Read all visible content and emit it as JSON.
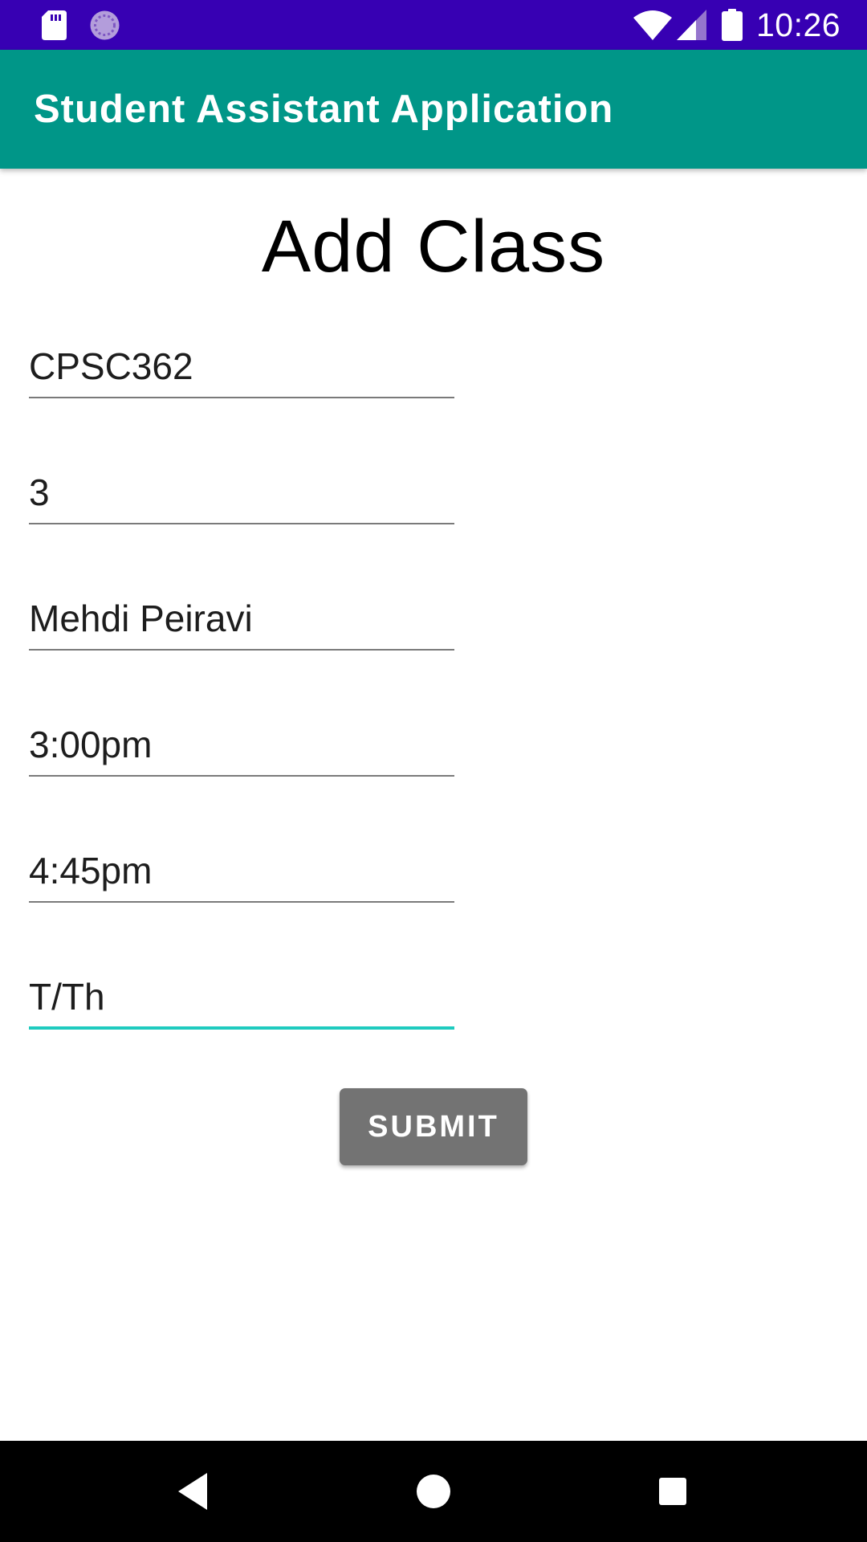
{
  "status_bar": {
    "time": "10:26",
    "background_color": "#3700b3",
    "icons": [
      "sd-card-icon",
      "sync-icon",
      "wifi-icon",
      "signal-icon",
      "battery-icon"
    ]
  },
  "app_bar": {
    "title": "Student Assistant Application",
    "background_color": "#009688"
  },
  "form": {
    "title": "Add Class",
    "fields": [
      {
        "name": "class-name",
        "value": "CPSC362",
        "focused": false
      },
      {
        "name": "units",
        "value": "3",
        "focused": false
      },
      {
        "name": "instructor",
        "value": "Mehdi Peiravi",
        "focused": false
      },
      {
        "name": "start-time",
        "value": "3:00pm",
        "focused": false
      },
      {
        "name": "end-time",
        "value": "4:45pm",
        "focused": false
      },
      {
        "name": "days",
        "value": "T/Th",
        "focused": true
      }
    ],
    "submit_label": "SUBMIT",
    "accent_color": "#1ecbbf",
    "button_color": "#737373"
  },
  "nav_bar": {
    "icons": [
      "back-icon",
      "home-icon",
      "recents-icon"
    ]
  }
}
